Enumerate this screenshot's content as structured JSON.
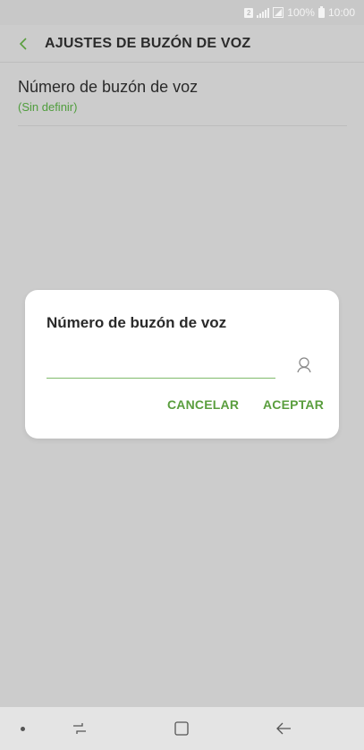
{
  "status_bar": {
    "sim_label": "2",
    "battery_percent": "100%",
    "time": "10:00"
  },
  "app_bar": {
    "title": "AJUSTES DE BUZÓN DE VOZ"
  },
  "setting": {
    "title": "Número de buzón de voz",
    "subtitle": "(Sin definir)"
  },
  "dialog": {
    "title": "Número de buzón de voz",
    "input_value": "",
    "cancel_label": "CANCELAR",
    "accept_label": "ACEPTAR"
  },
  "colors": {
    "accent": "#5a9e3e",
    "background": "#cccccc",
    "dialog_bg": "#ffffff"
  },
  "icons": {
    "back": "chevron-left-icon",
    "contact": "person-icon",
    "recents": "recents-icon",
    "home": "home-icon",
    "nav_back": "arrow-left-icon"
  }
}
